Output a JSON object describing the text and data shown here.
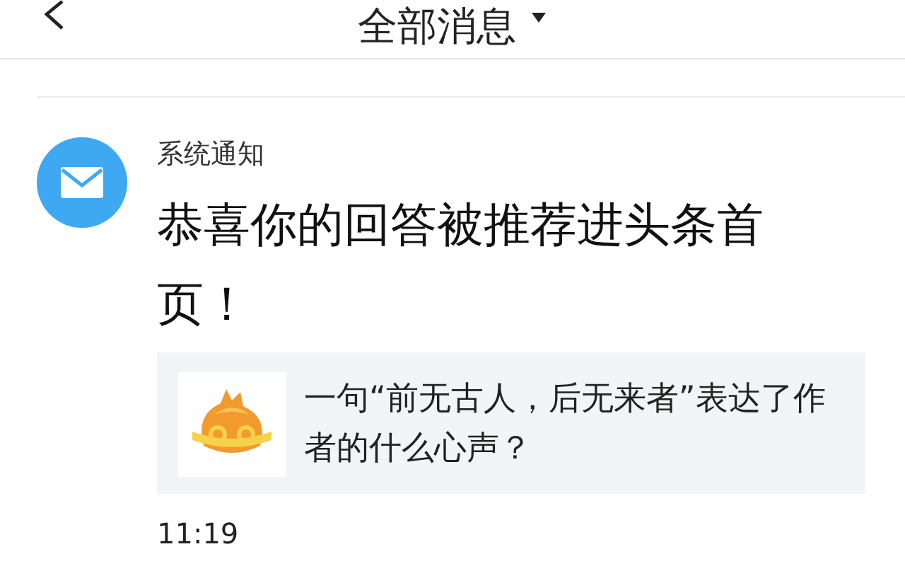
{
  "header": {
    "title": "全部消息"
  },
  "notifications": [
    {
      "sender": "系统通知",
      "message": "恭喜你的回答被推荐进头条首页！",
      "quote": {
        "text": "一句“前无古人，后无来者”表达了作者的什么心声？"
      },
      "time": "11:19"
    }
  ]
}
